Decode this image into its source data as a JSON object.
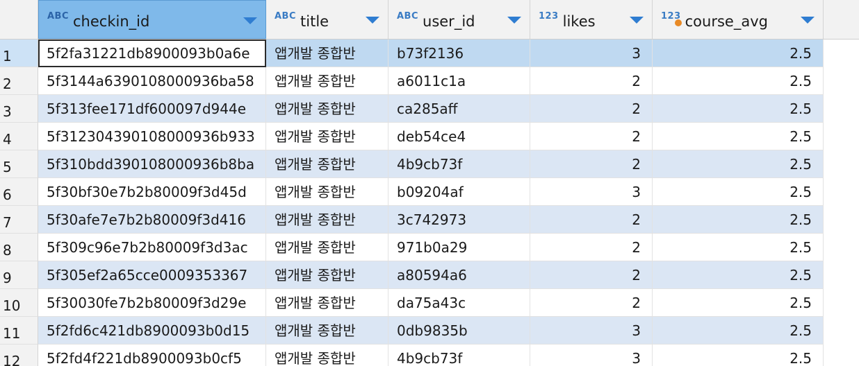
{
  "columns": [
    {
      "key": "checkin_id",
      "type_badge": "ABC",
      "name": "checkin_id"
    },
    {
      "key": "title",
      "type_badge": "ABC",
      "name": "title"
    },
    {
      "key": "user_id",
      "type_badge": "ABC",
      "name": "user_id"
    },
    {
      "key": "likes",
      "type_badge": "123",
      "name": "likes"
    },
    {
      "key": "course_avg",
      "type_badge": "123",
      "name": "course_avg"
    }
  ],
  "rows": [
    {
      "num": "1",
      "checkin_id": "5f2fa31221db8900093b0a6e",
      "title": "앱개발 종합반",
      "user_id": "b73f2136",
      "likes": "3",
      "course_avg": "2.5"
    },
    {
      "num": "2",
      "checkin_id": "5f3144a6390108000936ba58",
      "title": "앱개발 종합반",
      "user_id": "a6011c1a",
      "likes": "2",
      "course_avg": "2.5"
    },
    {
      "num": "3",
      "checkin_id": "5f313fee171df600097d944e",
      "title": "앱개발 종합반",
      "user_id": "ca285aff",
      "likes": "2",
      "course_avg": "2.5"
    },
    {
      "num": "4",
      "checkin_id": "5f312304390108000936b933",
      "title": "앱개발 종합반",
      "user_id": "deb54ce4",
      "likes": "2",
      "course_avg": "2.5"
    },
    {
      "num": "5",
      "checkin_id": "5f310bdd390108000936b8ba",
      "title": "앱개발 종합반",
      "user_id": "4b9cb73f",
      "likes": "2",
      "course_avg": "2.5"
    },
    {
      "num": "6",
      "checkin_id": "5f30bf30e7b2b80009f3d45d",
      "title": "앱개발 종합반",
      "user_id": "b09204af",
      "likes": "3",
      "course_avg": "2.5"
    },
    {
      "num": "7",
      "checkin_id": "5f30afe7e7b2b80009f3d416",
      "title": "앱개발 종합반",
      "user_id": "3c742973",
      "likes": "2",
      "course_avg": "2.5"
    },
    {
      "num": "8",
      "checkin_id": "5f309c96e7b2b80009f3d3ac",
      "title": "앱개발 종합반",
      "user_id": "971b0a29",
      "likes": "2",
      "course_avg": "2.5"
    },
    {
      "num": "9",
      "checkin_id": "5f305ef2a65cce0009353367",
      "title": "앱개발 종합반",
      "user_id": "a80594a6",
      "likes": "2",
      "course_avg": "2.5"
    },
    {
      "num": "10",
      "checkin_id": "5f30030fe7b2b80009f3d29e",
      "title": "앱개발 종합반",
      "user_id": "da75a43c",
      "likes": "2",
      "course_avg": "2.5"
    },
    {
      "num": "11",
      "checkin_id": "5f2fd6c421db8900093b0d15",
      "title": "앱개발 종합반",
      "user_id": "0db9835b",
      "likes": "3",
      "course_avg": "2.5"
    },
    {
      "num": "12",
      "checkin_id": "5f2fd4f221db8900093b0cf5",
      "title": "앱개발 종합반",
      "user_id": "4b9cb73f",
      "likes": "3",
      "course_avg": "2.5"
    }
  ],
  "colors": {
    "header_bg": "#f2f2f2",
    "selected_header_bg": "#7fb9ea",
    "alt_row_bg": "#dbe6f4",
    "selected_row_bg": "#bfd9f1",
    "type_badge": "#3a7cc4",
    "sort_arrow": "#2f7dd1",
    "key_dot": "#e88a26"
  },
  "icons": {
    "sort": "chevron-down-icon",
    "column_type_text": "abc-type-icon",
    "column_type_number": "number-type-icon"
  }
}
